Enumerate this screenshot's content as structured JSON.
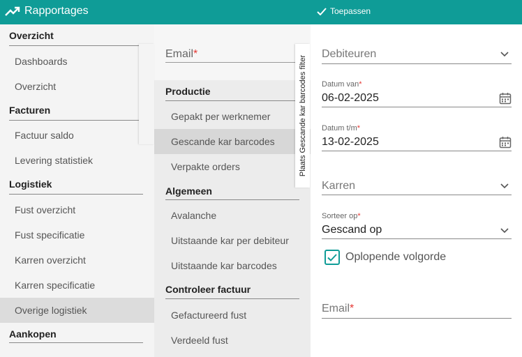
{
  "app": {
    "title": "Rapportages",
    "apply_label": "Toepassen",
    "accent": "#0f9c97"
  },
  "sidebar": {
    "sections": [
      {
        "title": "Overzicht",
        "items": [
          "Dashboards",
          "Overzicht"
        ]
      },
      {
        "title": "Facturen",
        "items": [
          "Factuur saldo",
          "Levering statistiek"
        ]
      },
      {
        "title": "Logistiek",
        "items": [
          "Fust overzicht",
          "Fust specificatie",
          "Karren overzicht",
          "Karren specificatie",
          "Overige logistiek"
        ]
      },
      {
        "title": "Aankopen",
        "items": []
      }
    ],
    "active_item": "Overige logistiek"
  },
  "submenu": {
    "email_label": "Email",
    "sections": [
      {
        "title": "Productie",
        "items": [
          "Gepakt per werknemer",
          "Gescande kar barcodes",
          "Verpakte orders"
        ]
      },
      {
        "title": "Algemeen",
        "items": [
          "Avalanche",
          "Uitstaande kar per debiteur",
          "Uitstaande kar barcodes"
        ]
      },
      {
        "title": "Controleer factuur",
        "items": [
          "Gefactureerd fust",
          "Verdeeld fust"
        ]
      }
    ],
    "active_item": "Gescande kar barcodes"
  },
  "filter_tab": {
    "label": "Plaats Gescande kar barcodes filter"
  },
  "form": {
    "debiteuren_placeholder": "Debiteuren",
    "datum_van_label": "Datum van",
    "datum_van_value": "06-02-2025",
    "datum_tm_label": "Datum t/m",
    "datum_tm_value": "13-02-2025",
    "karren_placeholder": "Karren",
    "sorteer_label": "Sorteer op",
    "sorteer_value": "Gescand op",
    "oplopend_label": "Oplopende volgorde",
    "oplopend_checked": true,
    "email_label": "Email"
  },
  "icons": {
    "brand": "trending-up-icon",
    "apply": "check-icon",
    "calendar": "calendar-icon",
    "select": "chevron-down-icon"
  }
}
